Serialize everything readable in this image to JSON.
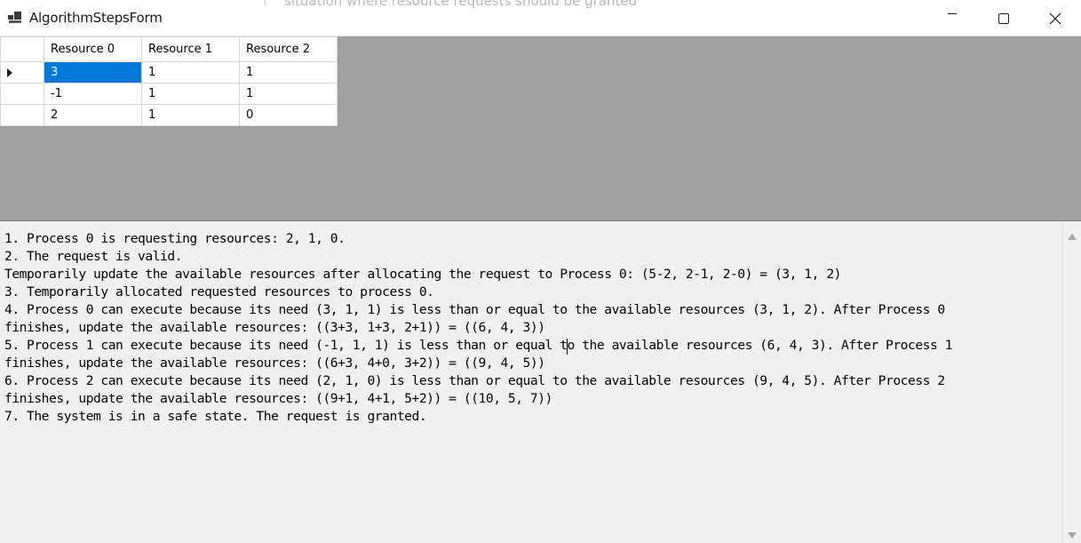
{
  "window": {
    "title": "AlgorithmStepsForm",
    "background_ghost_text": "situation where resource requests should be granted"
  },
  "grid": {
    "columns": [
      "Resource 0",
      "Resource 1",
      "Resource 2"
    ],
    "rows": [
      [
        "3",
        "1",
        "1"
      ],
      [
        "-1",
        "1",
        "1"
      ],
      [
        "2",
        "1",
        "0"
      ]
    ],
    "selected_cell": "row 1, Resource 0"
  },
  "steps": [
    "1. Process 0 is requesting resources: 2, 1, 0.",
    "2. The request is valid.",
    "Temporarily update the available resources after allocating the request to Process 0: (5-2, 2-1, 2-0) = (3, 1, 2)",
    "3. Temporarily allocated requested resources to process 0.",
    "4. Process 0 can execute because its need (3, 1, 1) is less than or equal to the available resources (3, 1, 2). After Process 0",
    "finishes, update the available resources: ((3+3, 1+3, 2+1)) = ((6, 4, 3))",
    "5. Process 1 can execute because its need (-1, 1, 1) is less than or equal to the available resources (6, 4, 3). After Process 1",
    "finishes, update the available resources: ((6+3, 4+0, 3+2)) = ((9, 4, 5))",
    "6. Process 2 can execute because its need (2, 1, 0) is less than or equal to the available resources (9, 4, 5). After Process 2",
    "finishes, update the available resources: ((9+1, 4+1, 5+2)) = ((10, 5, 7))",
    "7. The system is in a safe state. The request is granted."
  ],
  "colors": {
    "selection": "#0078d7",
    "grid_background": "#a0a0a0",
    "form_background": "#f0f0f0"
  },
  "icons": {
    "app": "app-icon",
    "minimize": "minimize-icon",
    "maximize": "maximize-icon",
    "close": "close-icon",
    "row_indicator": "row-indicator-icon"
  }
}
